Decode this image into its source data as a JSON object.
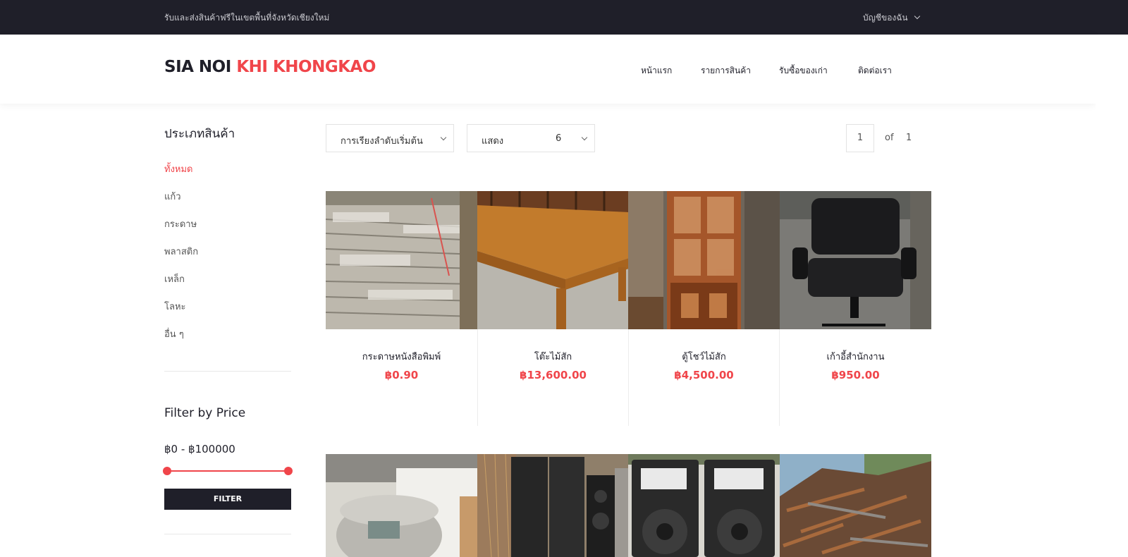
{
  "topbar": {
    "promo": "รับและส่งสินค้าฟรีในเขตพื้นที่จังหวัดเชียงใหม่",
    "account_label": "บัญชีของฉัน"
  },
  "header": {
    "logo_part1": "SIA NOI",
    "logo_part2": "KHI KHONGKAO",
    "nav": [
      "หน้าแรก",
      "รายการสินค้า",
      "รับซื้อของเก่า",
      "ติดต่อเรา"
    ]
  },
  "sidebar": {
    "title": "ประเภทสินค้า",
    "categories": [
      "ทั้งหมด",
      "แก้ว",
      "กระดาษ",
      "พลาสติก",
      "เหล็ก",
      "โลหะ",
      "อื่น ๆ"
    ],
    "filter_title": "Filter by Price",
    "price_range": "฿0 - ฿100000",
    "filter_button": "FILTER"
  },
  "toolbar": {
    "sort_label": "การเรียงลำดับเริ่มต้น",
    "show_label": "แสดง",
    "show_value": "6",
    "page_current": "1",
    "page_of": "of",
    "page_total": "1"
  },
  "products": [
    {
      "name": "กระดาษหนังสือพิมพ์",
      "price": "฿0.90"
    },
    {
      "name": "โต๊ะไม้สัก",
      "price": "฿13,600.00"
    },
    {
      "name": "ตู้โชว์ไม้สัก",
      "price": "฿4,500.00"
    },
    {
      "name": "เก้าอี้สำนักงาน",
      "price": "฿950.00"
    },
    {
      "name": "",
      "price": ""
    },
    {
      "name": "",
      "price": ""
    },
    {
      "name": "",
      "price": ""
    },
    {
      "name": "",
      "price": ""
    }
  ],
  "colors": {
    "accent": "#f0454a",
    "dark": "#1f1f29"
  }
}
